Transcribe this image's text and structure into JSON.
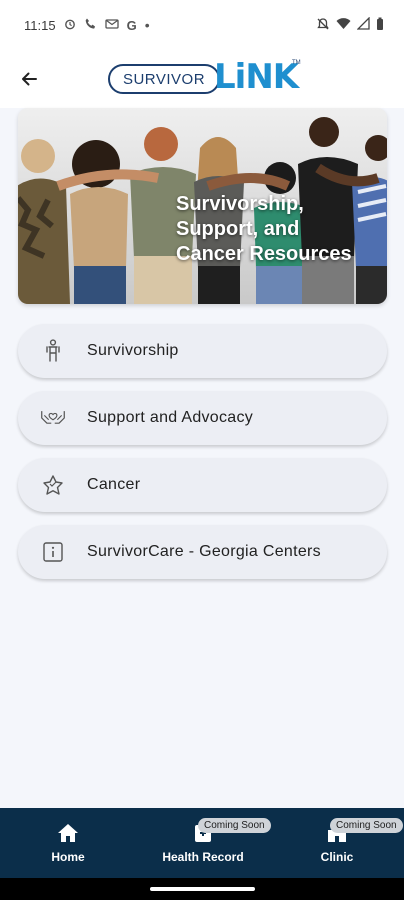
{
  "status_bar": {
    "time": "11:15",
    "icons_left": [
      "alarm-icon",
      "phone-icon",
      "mail-icon",
      "google-icon",
      "dot-icon"
    ],
    "icons_right": [
      "mute-icon",
      "wifi-icon",
      "signal-icon",
      "battery-icon"
    ],
    "google_letter": "G"
  },
  "header": {
    "logo_text_left": "SURVIVOR",
    "logo_text_right": "LiNK",
    "logo_tm": "TM"
  },
  "hero": {
    "title_line1": "Survivorship,",
    "title_line2": "Support, and",
    "title_line3": "Cancer Resources"
  },
  "menu": {
    "items": [
      {
        "label": "Survivorship",
        "icon": "person-icon"
      },
      {
        "label": "Support and Advocacy",
        "icon": "hands-heart-icon"
      },
      {
        "label": "Cancer",
        "icon": "ribbon-star-icon"
      },
      {
        "label": "SurvivorCare - Georgia Centers",
        "icon": "info-icon"
      }
    ]
  },
  "bottom_nav": {
    "items": [
      {
        "label": "Home",
        "icon": "home-icon"
      },
      {
        "label": "Health Record",
        "icon": "health-record-icon",
        "badge": "Coming Soon"
      },
      {
        "label": "Clinic",
        "icon": "clinic-icon",
        "badge": "Coming Soon"
      }
    ]
  },
  "colors": {
    "nav_bg": "#0b2e4a",
    "logo_blue": "#1f8fcf",
    "logo_navy": "#1c3e6e",
    "menu_bg": "#eceef4",
    "page_bg": "#f4f6fb"
  }
}
